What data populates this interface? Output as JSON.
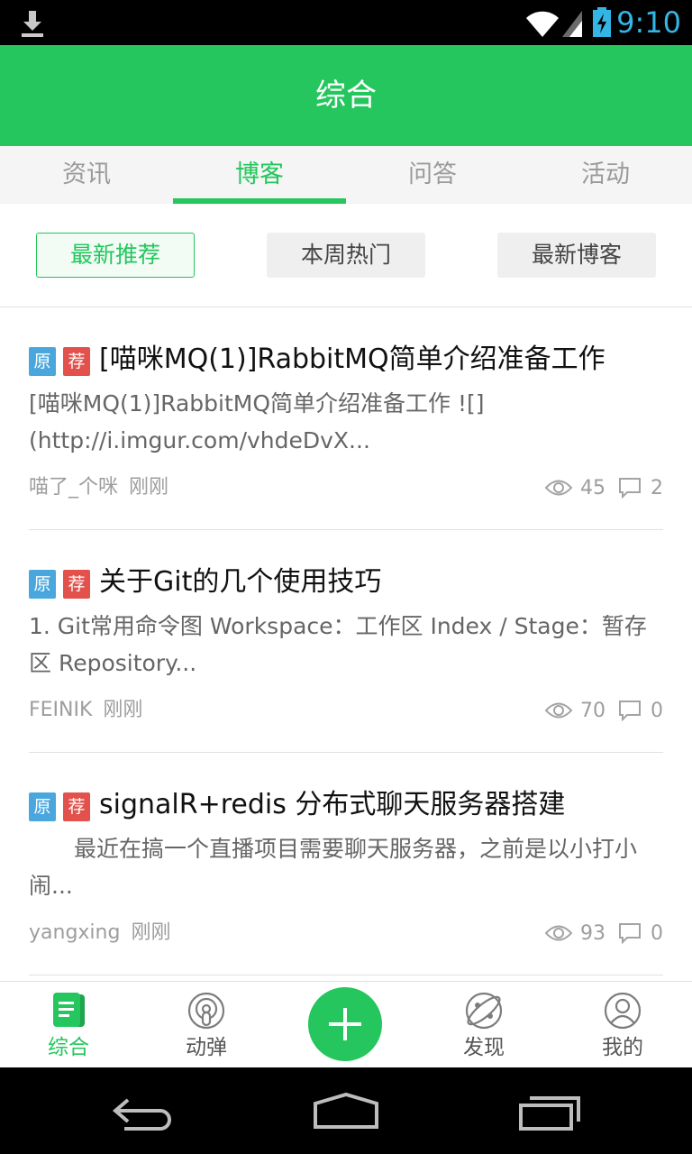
{
  "status_bar": {
    "time": "9:10"
  },
  "header": {
    "title": "综合"
  },
  "tabs": [
    {
      "label": "资讯"
    },
    {
      "label": "博客"
    },
    {
      "label": "问答"
    },
    {
      "label": "活动"
    }
  ],
  "filters": [
    {
      "label": "最新推荐"
    },
    {
      "label": "本周热门"
    },
    {
      "label": "最新博客"
    }
  ],
  "badges": {
    "original": "原",
    "recommended": "荐"
  },
  "posts": [
    {
      "title": "[喵咪MQ(1)]RabbitMQ简单介绍准备工作",
      "summary": "[喵咪MQ(1)]RabbitMQ简单介绍准备工作 ![](http://i.imgur.com/vhdeDvX...",
      "author": "喵了_个咪",
      "time": "刚刚",
      "views": "45",
      "comments": "2"
    },
    {
      "title": "关于Git的几个使用技巧",
      "summary": "1. Git常用命令图 Workspace：工作区 Index / Stage：暂存区 Repository...",
      "author": "FEINIK",
      "time": "刚刚",
      "views": "70",
      "comments": "0"
    },
    {
      "title": "signalR+redis 分布式聊天服务器搭建",
      "summary": "　　最近在搞一个直播项目需要聊天服务器，之前是以小打小闹...",
      "author": "yangxing",
      "time": "刚刚",
      "views": "93",
      "comments": "0"
    }
  ],
  "bottom_nav": [
    {
      "label": "综合",
      "icon": "news-icon"
    },
    {
      "label": "动弹",
      "icon": "tweet-icon"
    },
    {
      "label": "",
      "icon": "plus-icon"
    },
    {
      "label": "发现",
      "icon": "discover-icon"
    },
    {
      "label": "我的",
      "icon": "profile-icon"
    }
  ],
  "colors": {
    "brand": "#24c65d",
    "original_badge": "#4aa7dd",
    "recommend_badge": "#e2514b",
    "clock": "#33b5e5"
  }
}
